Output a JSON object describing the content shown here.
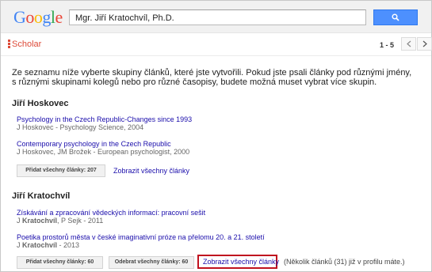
{
  "header": {
    "logo_letters": [
      {
        "char": "G",
        "color": "#4285f4"
      },
      {
        "char": "o",
        "color": "#ea4335"
      },
      {
        "char": "o",
        "color": "#fbbc05"
      },
      {
        "char": "g",
        "color": "#4285f4"
      },
      {
        "char": "l",
        "color": "#34a853"
      },
      {
        "char": "e",
        "color": "#ea4335"
      }
    ],
    "search_value": "Mgr. Jiří Kratochvíl, Ph.D.",
    "search_icon": "magnifier-icon"
  },
  "subbar": {
    "section_label": "Scholar",
    "pager_text": "1 - 5",
    "prev_icon": "chevron-left-icon",
    "next_icon": "chevron-right-icon"
  },
  "intro_text": "Ze seznamu níže vyberte skupiny článků, které jste vytvořili. Pokud jste psali články pod různými jmény, s různými skupinami kolegů nebo pro různé časopisy, budete možná muset vybrat více skupin.",
  "groups": [
    {
      "author": "Jiří Hoskovec",
      "articles": [
        {
          "title": "Psychology in the Czech Republic-Changes since 1993",
          "meta": "J Hoskovec - Psychology Science, 2004"
        },
        {
          "title": "Contemporary psychology in the Czech Republic",
          "meta": "J Hoskovec, JM Brožek - European psychologist, 2000"
        }
      ],
      "add_button": "Přidat všechny články: 207",
      "show_link": "Zobrazit všechny články"
    },
    {
      "author": "Jiří Kratochvíl",
      "articles": [
        {
          "title": "Získávání a zpracování vědeckých informací: pracovní sešit",
          "meta_bold": "Kratochvíl",
          "meta_prefix": "J ",
          "meta_suffix": ", P Sejk - 2011"
        },
        {
          "title": "Poetika prostorů města v české imaginativní próze na přelomu 20. a 21. století",
          "meta_bold": "Kratochvíl",
          "meta_prefix": "J ",
          "meta_suffix": " - 2013"
        }
      ],
      "add_button": "Přidat všechny články: 60",
      "remove_button": "Odebrat všechny články: 60",
      "show_link": "Zobrazit všechny články",
      "note": "(Několik článků (31) již v profilu máte.)"
    }
  ],
  "colors": {
    "accent_blue": "#4d90fe",
    "link": "#1a0dab",
    "scholar_red": "#dd4b39",
    "highlight_red": "#c0111f"
  }
}
